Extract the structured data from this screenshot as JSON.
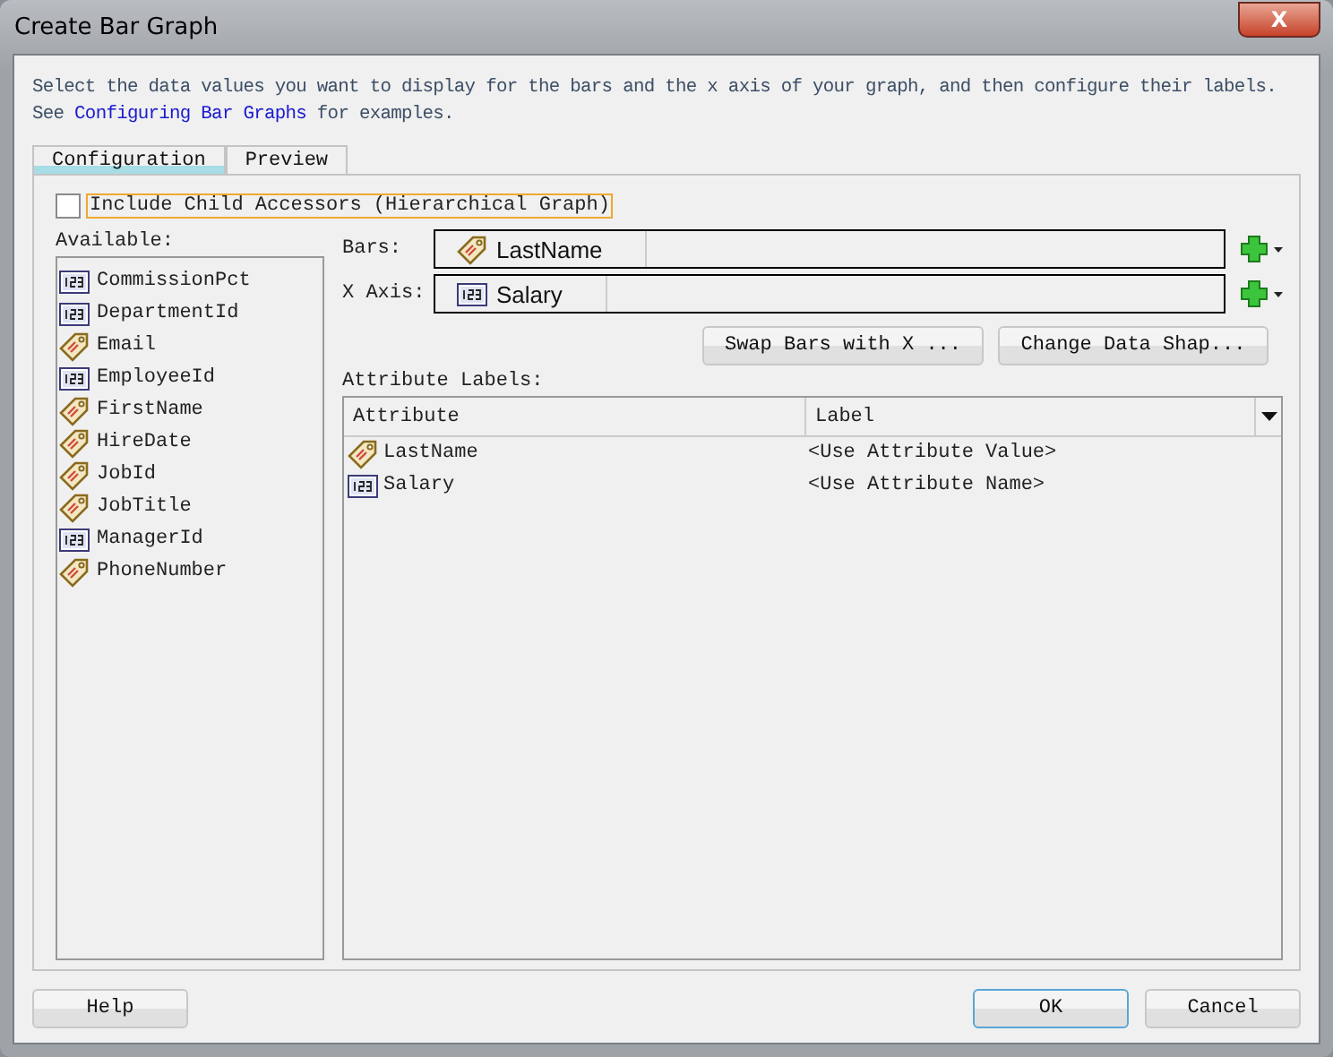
{
  "window": {
    "title": "Create Bar Graph",
    "close": "X"
  },
  "description": {
    "text": "Select the data values you want to display for the bars and the x axis of your graph, and then configure their labels.",
    "see": "See",
    "link": "Configuring Bar Graphs",
    "after": "for examples."
  },
  "tabs": [
    {
      "label": "Configuration",
      "selected": true
    },
    {
      "label": "Preview",
      "selected": false
    }
  ],
  "include_child": {
    "label": "Include Child Accessors (Hierarchical Graph)",
    "checked": false
  },
  "available": {
    "label": "Available:",
    "items": [
      {
        "name": "CommissionPct",
        "kind": "number"
      },
      {
        "name": "DepartmentId",
        "kind": "number"
      },
      {
        "name": "Email",
        "kind": "text"
      },
      {
        "name": "EmployeeId",
        "kind": "number"
      },
      {
        "name": "FirstName",
        "kind": "text"
      },
      {
        "name": "HireDate",
        "kind": "text"
      },
      {
        "name": "JobId",
        "kind": "text"
      },
      {
        "name": "JobTitle",
        "kind": "text"
      },
      {
        "name": "ManagerId",
        "kind": "number"
      },
      {
        "name": "PhoneNumber",
        "kind": "text"
      }
    ]
  },
  "fields": [
    {
      "label": "Bars:",
      "value": "LastName",
      "kind": "text"
    },
    {
      "label": "X Axis:",
      "value": "Salary",
      "kind": "number"
    }
  ],
  "actions": [
    "Swap Bars with X ...",
    "Change Data Shap..."
  ],
  "attribute_labels": {
    "label": "Attribute Labels:",
    "columns": [
      "Attribute",
      "Label"
    ],
    "rows": [
      {
        "attribute": "LastName",
        "kind": "text",
        "label": "<Use Attribute Value>"
      },
      {
        "attribute": "Salary",
        "kind": "number",
        "label": "<Use Attribute Name>"
      }
    ]
  },
  "footer": {
    "help": "Help",
    "ok": "OK",
    "cancel": "Cancel"
  }
}
